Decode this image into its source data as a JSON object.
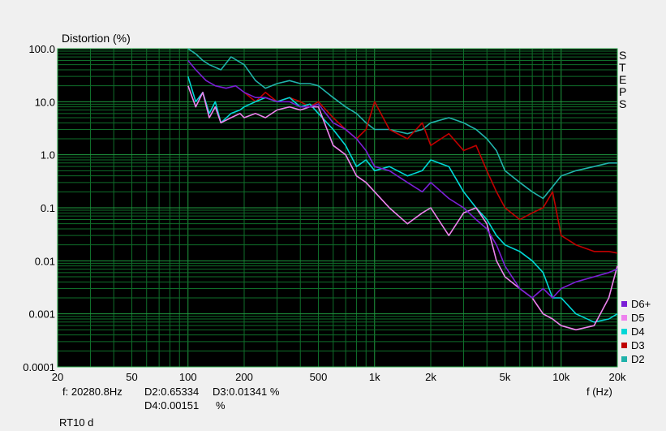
{
  "chart_data": {
    "type": "line",
    "ylabel": "Distortion (%)",
    "xlabel": "f (Hz)",
    "x_scale": "log",
    "y_scale": "log",
    "xlim": [
      20,
      20000
    ],
    "ylim": [
      0.0001,
      100
    ],
    "x_ticks": [
      20,
      50,
      100,
      200,
      500,
      1000,
      2000,
      5000,
      10000,
      20000
    ],
    "x_tick_labels": [
      "20",
      "50",
      "100",
      "200",
      "500",
      "1k",
      "2k",
      "5k",
      "10k",
      "20k"
    ],
    "y_ticks": [
      100,
      10,
      1,
      0.1,
      0.01,
      0.001,
      0.0001
    ],
    "y_tick_labels": [
      "100.0",
      "10.0",
      "1.0",
      "0.1",
      "0.01",
      "0.001",
      "0.0001"
    ],
    "grid": true,
    "legend_position": "bottom-right",
    "series": [
      {
        "name": "D6+",
        "color": "#7b1fd6",
        "x": [
          100,
          110,
          125,
          140,
          160,
          180,
          200,
          230,
          260,
          300,
          350,
          400,
          450,
          500,
          600,
          700,
          800,
          900,
          1000,
          1200,
          1500,
          1800,
          2000,
          2500,
          3000,
          3500,
          4000,
          4500,
          5000,
          6000,
          7000,
          8000,
          9000,
          10000,
          12000,
          15000,
          18000,
          20000
        ],
        "y": [
          60,
          40,
          25,
          20,
          18,
          20,
          15,
          12,
          12,
          10,
          10,
          8,
          8,
          9,
          4,
          3,
          2,
          1.2,
          0.6,
          0.5,
          0.3,
          0.2,
          0.3,
          0.15,
          0.1,
          0.06,
          0.04,
          0.02,
          0.008,
          0.003,
          0.002,
          0.003,
          0.002,
          0.003,
          0.004,
          0.005,
          0.006,
          0.007
        ]
      },
      {
        "name": "D5",
        "color": "#ee82ee",
        "x": [
          100,
          110,
          120,
          130,
          140,
          150,
          170,
          190,
          200,
          230,
          260,
          300,
          350,
          400,
          450,
          500,
          600,
          700,
          800,
          900,
          1000,
          1200,
          1500,
          1800,
          2000,
          2500,
          3000,
          3500,
          4000,
          4500,
          5000,
          6000,
          7000,
          8000,
          9000,
          10000,
          12000,
          15000,
          18000,
          20000
        ],
        "y": [
          20,
          8,
          15,
          5,
          8,
          4,
          5,
          6,
          5,
          6,
          5,
          7,
          8,
          7,
          8,
          8,
          1.5,
          1,
          0.4,
          0.3,
          0.2,
          0.1,
          0.05,
          0.08,
          0.1,
          0.03,
          0.08,
          0.1,
          0.05,
          0.01,
          0.005,
          0.003,
          0.002,
          0.001,
          0.0008,
          0.0006,
          0.0005,
          0.0006,
          0.002,
          0.008
        ]
      },
      {
        "name": "D4",
        "color": "#00d7d7",
        "x": [
          100,
          110,
          120,
          130,
          140,
          150,
          170,
          190,
          200,
          230,
          260,
          300,
          350,
          400,
          450,
          500,
          600,
          700,
          800,
          900,
          1000,
          1200,
          1500,
          1800,
          2000,
          2500,
          3000,
          3500,
          4000,
          4500,
          5000,
          6000,
          7000,
          8000,
          9000,
          10000,
          12000,
          15000,
          18000,
          20000
        ],
        "y": [
          30,
          10,
          15,
          6,
          10,
          4,
          6,
          7,
          8,
          10,
          12,
          10,
          12,
          8,
          9,
          6,
          3,
          1.5,
          0.6,
          0.8,
          0.5,
          0.6,
          0.4,
          0.5,
          0.8,
          0.6,
          0.2,
          0.1,
          0.06,
          0.03,
          0.02,
          0.015,
          0.01,
          0.006,
          0.002,
          0.002,
          0.001,
          0.0007,
          0.0008,
          0.001
        ]
      },
      {
        "name": "D3",
        "color": "#c00000",
        "x": [
          200,
          230,
          260,
          300,
          350,
          400,
          450,
          500,
          600,
          700,
          800,
          900,
          1000,
          1200,
          1500,
          1800,
          2000,
          2500,
          3000,
          3500,
          4000,
          4500,
          5000,
          6000,
          7000,
          8000,
          9000,
          10000,
          12000,
          15000,
          18000,
          20000
        ],
        "y": [
          15,
          10,
          15,
          10,
          12,
          10,
          8,
          10,
          5,
          3,
          2,
          3,
          10,
          3,
          2,
          4,
          1.5,
          2.5,
          1.2,
          1.5,
          0.5,
          0.2,
          0.1,
          0.06,
          0.08,
          0.1,
          0.2,
          0.03,
          0.02,
          0.015,
          0.015,
          0.014
        ]
      },
      {
        "name": "D2",
        "color": "#20b2aa",
        "x": [
          100,
          110,
          120,
          130,
          150,
          170,
          200,
          230,
          260,
          300,
          350,
          400,
          450,
          500,
          600,
          700,
          800,
          900,
          1000,
          1200,
          1500,
          1800,
          2000,
          2500,
          3000,
          3500,
          4000,
          4500,
          5000,
          6000,
          7000,
          8000,
          9000,
          10000,
          12000,
          15000,
          18000,
          20000
        ],
        "y": [
          100,
          80,
          60,
          50,
          40,
          70,
          50,
          25,
          18,
          22,
          25,
          22,
          22,
          20,
          12,
          8,
          6,
          4,
          3,
          3,
          2.5,
          3,
          4,
          5,
          4,
          3,
          2,
          1.2,
          0.5,
          0.3,
          0.2,
          0.15,
          0.25,
          0.4,
          0.5,
          0.6,
          0.7,
          0.7
        ]
      }
    ]
  },
  "readout": {
    "freq": "f: 20280.8Hz",
    "d2": "D2:0.65334",
    "d3": "D3:0.01341 %",
    "d4": "D4:0.00151",
    "d4_unit": "%"
  },
  "steps_letters": [
    "S",
    "T",
    "E",
    "P",
    "S"
  ],
  "footer_label": "RT10 d"
}
